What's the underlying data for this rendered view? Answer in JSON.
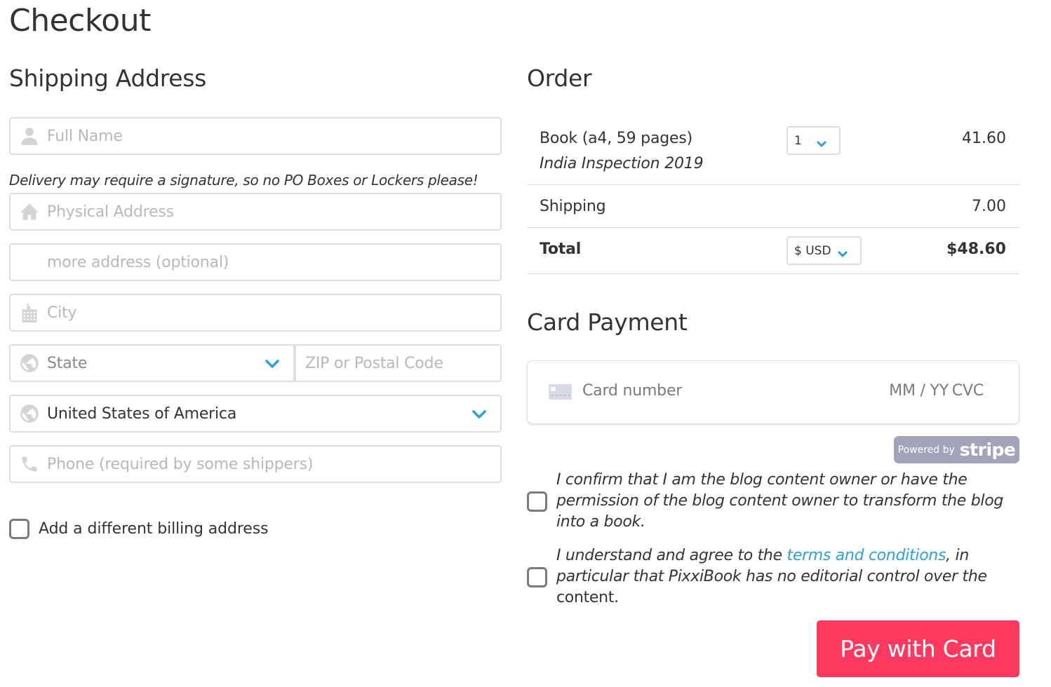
{
  "page": {
    "title": "Checkout"
  },
  "shipping": {
    "heading": "Shipping Address",
    "delivery_note": "Delivery may require a signature, so no PO Boxes or Lockers please!",
    "fields": {
      "full_name": {
        "placeholder": "Full Name",
        "icon": "user-icon"
      },
      "address": {
        "placeholder": "Physical Address",
        "icon": "home-icon"
      },
      "address2": {
        "placeholder": "more address (optional)"
      },
      "city": {
        "placeholder": "City",
        "icon": "building-icon"
      },
      "state": {
        "placeholder": "State",
        "icon": "globe-icon"
      },
      "zip": {
        "placeholder": "ZIP or Postal Code"
      },
      "country": {
        "value": "United States of America",
        "icon": "globe-icon"
      },
      "phone": {
        "placeholder": "Phone (required by some shippers)",
        "icon": "phone-icon"
      }
    },
    "billing_checkbox_label": "Add a different billing address",
    "billing_checked": false
  },
  "order": {
    "heading": "Order",
    "item": {
      "name": "Book (a4, 59 pages)",
      "subtitle": "India Inspection 2019",
      "quantity": "1",
      "price": "41.60"
    },
    "shipping_label": "Shipping",
    "shipping_price": "7.00",
    "total_label": "Total",
    "currency": "$ USD",
    "total": "$48.60"
  },
  "payment": {
    "heading": "Card Payment",
    "card_number_placeholder": "Card number",
    "expiry_placeholder": "MM / YY",
    "cvc_placeholder": "CVC",
    "powered_by": "Powered by",
    "stripe": "stripe",
    "agreements": [
      {
        "text": "I confirm that I am the blog content owner or have the permission of the blog content owner to transform the blog into a book.",
        "checked": false
      },
      {
        "text_before": "I understand and agree to the ",
        "link": "terms and conditions",
        "text_after": ", in particular that PixxiBook has no editorial control over the ",
        "text_plain": "content.",
        "checked": false
      }
    ],
    "pay_button": "Pay with Card"
  },
  "colors": {
    "accent_blue": "#2d9ee0",
    "pay_button": "#ff3860",
    "stripe_badge": "#a3a3ba"
  }
}
